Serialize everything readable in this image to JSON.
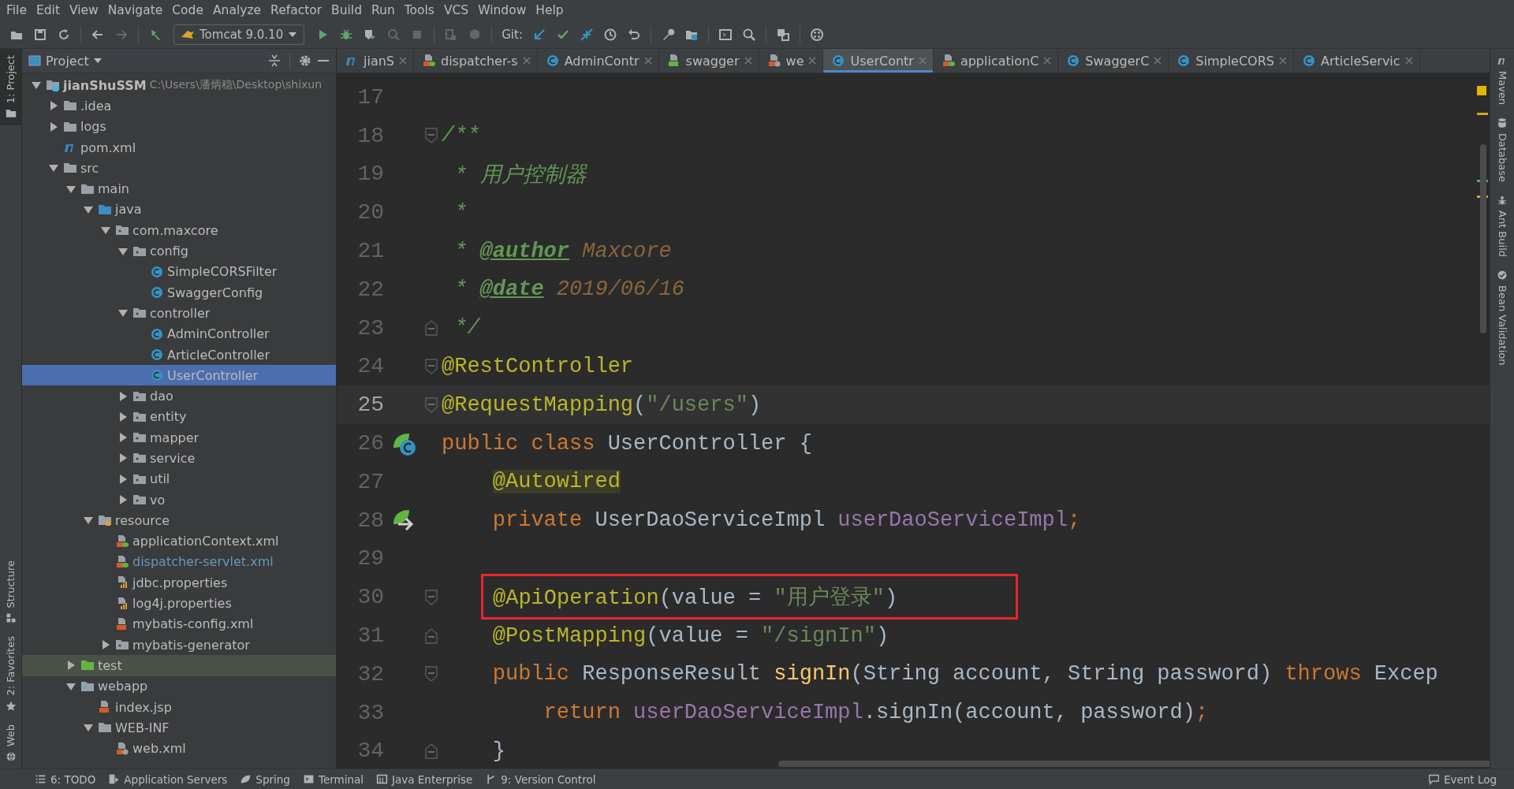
{
  "menu": [
    "File",
    "Edit",
    "View",
    "Navigate",
    "Code",
    "Analyze",
    "Refactor",
    "Build",
    "Run",
    "Tools",
    "VCS",
    "Window",
    "Help"
  ],
  "toolbar": {
    "items": [
      {
        "kind": "button",
        "disabled": false
      },
      {
        "kind": "button",
        "disabled": false
      },
      {
        "kind": "button",
        "disabled": false
      },
      {
        "kind": "separator"
      },
      {
        "kind": "button",
        "disabled": false
      },
      {
        "kind": "button",
        "disabled": true
      },
      {
        "kind": "separator"
      },
      {
        "kind": "button",
        "disabled": false
      },
      {
        "kind": "run-config",
        "label": "Tomcat 9.0.10"
      },
      {
        "kind": "button",
        "disabled": false
      },
      {
        "kind": "button",
        "disabled": false
      },
      {
        "kind": "button",
        "disabled": false
      },
      {
        "kind": "button",
        "disabled": true
      },
      {
        "kind": "button",
        "disabled": true
      },
      {
        "kind": "separator"
      },
      {
        "kind": "button",
        "disabled": true
      },
      {
        "kind": "button",
        "disabled": true
      },
      {
        "kind": "separator"
      },
      {
        "kind": "label",
        "text": "Git:"
      },
      {
        "kind": "button",
        "disabled": false
      },
      {
        "kind": "button",
        "disabled": false
      },
      {
        "kind": "button",
        "disabled": false
      },
      {
        "kind": "button",
        "disabled": false
      },
      {
        "kind": "button",
        "disabled": false
      },
      {
        "kind": "separator"
      },
      {
        "kind": "button",
        "disabled": false
      },
      {
        "kind": "button",
        "disabled": false
      },
      {
        "kind": "separator"
      },
      {
        "kind": "button",
        "disabled": false
      },
      {
        "kind": "button",
        "disabled": false
      },
      {
        "kind": "separator"
      },
      {
        "kind": "button",
        "disabled": false
      },
      {
        "kind": "separator"
      },
      {
        "kind": "button",
        "disabled": false
      }
    ]
  },
  "left_strip": [
    {
      "label": "1: Project",
      "selected": true
    },
    {
      "label": "Structure",
      "selected": false
    },
    {
      "label": "2: Favorites",
      "selected": false
    },
    {
      "label": "Web",
      "selected": false
    }
  ],
  "project": {
    "title": "Project",
    "tree": [
      {
        "name": "jianShuSSM",
        "path": "C:\\Users\\潘炳稳\\Desktop\\shixun",
        "kind": "module",
        "expanded": true,
        "selected": false,
        "modified": false,
        "children": [
          {
            "name": ".idea",
            "kind": "folder",
            "expanded": false,
            "selected": false,
            "modified": false
          },
          {
            "name": "logs",
            "kind": "folder",
            "expanded": false,
            "selected": false,
            "modified": false
          },
          {
            "name": "pom.xml",
            "kind": "maven",
            "selected": false,
            "modified": false
          },
          {
            "name": "src",
            "kind": "folder",
            "expanded": true,
            "selected": false,
            "modified": false,
            "children": [
              {
                "name": "main",
                "kind": "folder",
                "expanded": true,
                "selected": false,
                "modified": false,
                "children": [
                  {
                    "name": "java",
                    "kind": "source-folder",
                    "expanded": true,
                    "selected": false,
                    "modified": false,
                    "children": [
                      {
                        "name": "com.maxcore",
                        "kind": "package",
                        "expanded": true,
                        "selected": false,
                        "modified": false,
                        "children": [
                          {
                            "name": "config",
                            "kind": "package",
                            "expanded": true,
                            "selected": false,
                            "modified": false,
                            "children": [
                              {
                                "name": "SimpleCORSFilter",
                                "kind": "class",
                                "selected": false,
                                "modified": false
                              },
                              {
                                "name": "SwaggerConfig",
                                "kind": "class",
                                "selected": false,
                                "modified": false
                              }
                            ]
                          },
                          {
                            "name": "controller",
                            "kind": "package",
                            "expanded": true,
                            "selected": false,
                            "modified": false,
                            "children": [
                              {
                                "name": "AdminController",
                                "kind": "class",
                                "selected": false,
                                "modified": false
                              },
                              {
                                "name": "ArticleController",
                                "kind": "class",
                                "selected": false,
                                "modified": false
                              },
                              {
                                "name": "UserController",
                                "kind": "class",
                                "selected": true,
                                "modified": false
                              }
                            ]
                          },
                          {
                            "name": "dao",
                            "kind": "package",
                            "expanded": false,
                            "selected": false,
                            "modified": false
                          },
                          {
                            "name": "entity",
                            "kind": "package",
                            "expanded": false,
                            "selected": false,
                            "modified": false
                          },
                          {
                            "name": "mapper",
                            "kind": "package",
                            "expanded": false,
                            "selected": false,
                            "modified": false
                          },
                          {
                            "name": "service",
                            "kind": "package",
                            "expanded": false,
                            "selected": false,
                            "modified": false
                          },
                          {
                            "name": "util",
                            "kind": "package",
                            "expanded": false,
                            "selected": false,
                            "modified": false
                          },
                          {
                            "name": "vo",
                            "kind": "package",
                            "expanded": false,
                            "selected": false,
                            "modified": false
                          }
                        ]
                      }
                    ]
                  },
                  {
                    "name": "resource",
                    "kind": "resource-folder",
                    "expanded": true,
                    "selected": false,
                    "modified": false,
                    "children": [
                      {
                        "name": "applicationContext.xml",
                        "kind": "spring-xml",
                        "selected": false,
                        "modified": false
                      },
                      {
                        "name": "dispatcher-servlet.xml",
                        "kind": "spring-xml",
                        "selected": false,
                        "modified": true
                      },
                      {
                        "name": "jdbc.properties",
                        "kind": "properties",
                        "selected": false,
                        "modified": false
                      },
                      {
                        "name": "log4j.properties",
                        "kind": "properties",
                        "selected": false,
                        "modified": false
                      },
                      {
                        "name": "mybatis-config.xml",
                        "kind": "xml",
                        "selected": false,
                        "modified": false
                      },
                      {
                        "name": "mybatis-generator",
                        "kind": "package",
                        "expanded": false,
                        "selected": false,
                        "modified": false
                      }
                    ]
                  }
                ]
              },
              {
                "name": "test",
                "kind": "test-folder",
                "expanded": false,
                "selected": false,
                "modified": false
              },
              {
                "name": "webapp",
                "kind": "web-folder",
                "expanded": true,
                "selected": false,
                "modified": false,
                "children": [
                  {
                    "name": "index.jsp",
                    "kind": "jsp",
                    "selected": false,
                    "modified": false
                  },
                  {
                    "name": "WEB-INF",
                    "kind": "folder",
                    "expanded": true,
                    "selected": false,
                    "modified": false,
                    "children": [
                      {
                        "name": "web.xml",
                        "kind": "web-xml",
                        "selected": false,
                        "modified": false
                      }
                    ]
                  }
                ]
              }
            ]
          }
        ]
      }
    ]
  },
  "tabs": [
    {
      "label": "jianS",
      "kind": "maven",
      "selected": false
    },
    {
      "label": "dispatcher-s",
      "kind": "spring-xml",
      "selected": false
    },
    {
      "label": "AdminContr",
      "kind": "class",
      "selected": false
    },
    {
      "label": "swagger",
      "kind": "html",
      "selected": false
    },
    {
      "label": "we",
      "kind": "web-xml",
      "selected": false
    },
    {
      "label": "UserContr",
      "kind": "class",
      "selected": true
    },
    {
      "label": "applicationC",
      "kind": "spring-xml",
      "selected": false
    },
    {
      "label": "SwaggerC",
      "kind": "class",
      "selected": false
    },
    {
      "label": "SimpleCORS",
      "kind": "class",
      "selected": false
    },
    {
      "label": "ArticleServic",
      "kind": "class",
      "selected": false
    }
  ],
  "code": [
    {
      "number": "17",
      "current": false,
      "boxed": false,
      "fold_start": false,
      "fold_end": false
    },
    {
      "number": "18",
      "current": false,
      "boxed": false,
      "fold_start": true,
      "fold_end": false,
      "tokens": [
        {
          "text": "/**",
          "kind": "comment"
        }
      ]
    },
    {
      "number": "19",
      "current": false,
      "boxed": false,
      "fold_start": false,
      "fold_end": false,
      "tokens": [
        {
          "text": " * 用户控制器",
          "kind": "comment"
        }
      ]
    },
    {
      "number": "20",
      "current": false,
      "boxed": false,
      "fold_start": false,
      "fold_end": false,
      "tokens": [
        {
          "text": " *",
          "kind": "comment"
        }
      ]
    },
    {
      "number": "21",
      "current": false,
      "boxed": false,
      "fold_start": false,
      "fold_end": false,
      "tokens": [
        {
          "text": " * ",
          "kind": "comment"
        },
        {
          "text": "@author",
          "kind": "doctag"
        },
        {
          "text": " Maxcore",
          "kind": "docval"
        }
      ]
    },
    {
      "number": "22",
      "current": false,
      "boxed": false,
      "fold_start": false,
      "fold_end": false,
      "tokens": [
        {
          "text": " * ",
          "kind": "comment"
        },
        {
          "text": "@date",
          "kind": "doctag"
        },
        {
          "text": " 2019/06/16",
          "kind": "docval"
        }
      ]
    },
    {
      "number": "23",
      "current": false,
      "boxed": false,
      "fold_start": false,
      "fold_end": true,
      "tokens": [
        {
          "text": " */",
          "kind": "comment"
        }
      ]
    },
    {
      "number": "24",
      "current": false,
      "boxed": false,
      "fold_start": true,
      "fold_end": false,
      "tokens": [
        {
          "text": "@RestController",
          "kind": "annotation"
        }
      ]
    },
    {
      "number": "25",
      "current": true,
      "boxed": false,
      "fold_start": true,
      "fold_end": false,
      "tokens": [
        {
          "text": "@RequestMapping",
          "kind": "annotation"
        },
        {
          "text": "(",
          "kind": "plain"
        },
        {
          "text": "\"/users\"",
          "kind": "string"
        },
        {
          "text": ")",
          "kind": "plain"
        }
      ]
    },
    {
      "number": "26",
      "current": false,
      "boxed": false,
      "fold_start": false,
      "fold_end": false,
      "gutter": {
        "kind": "bean"
      },
      "tokens": [
        {
          "text": "public class",
          "kind": "keyword"
        },
        {
          "text": " UserController {",
          "kind": "plain"
        }
      ]
    },
    {
      "number": "27",
      "current": false,
      "boxed": false,
      "fold_start": false,
      "fold_end": false,
      "tokens": [
        {
          "text": "    @Autowired",
          "kind": "annotation-hl"
        }
      ]
    },
    {
      "number": "28",
      "current": false,
      "boxed": false,
      "fold_start": false,
      "fold_end": false,
      "gutter": {
        "kind": "inject"
      },
      "tokens": [
        {
          "text": "    private",
          "kind": "keyword"
        },
        {
          "text": " UserDaoServiceImpl ",
          "kind": "plain"
        },
        {
          "text": "userDaoServiceImpl",
          "kind": "field"
        },
        {
          "text": ";",
          "kind": "keyword"
        }
      ]
    },
    {
      "number": "29",
      "current": false,
      "boxed": false,
      "fold_start": false,
      "fold_end": false
    },
    {
      "number": "30",
      "current": false,
      "boxed": true,
      "fold_start": true,
      "fold_end": false,
      "tokens": [
        {
          "text": "@ApiOperation",
          "kind": "annotation"
        },
        {
          "text": "(value = ",
          "kind": "plain"
        },
        {
          "text": "\"用户登录\"",
          "kind": "string"
        },
        {
          "text": ")",
          "kind": "plain"
        }
      ]
    },
    {
      "number": "31",
      "current": false,
      "boxed": false,
      "fold_start": false,
      "fold_end": true,
      "tokens": [
        {
          "text": "    @PostMapping",
          "kind": "annotation"
        },
        {
          "text": "(value = ",
          "kind": "plain"
        },
        {
          "text": "\"/signIn\"",
          "kind": "string"
        },
        {
          "text": ")",
          "kind": "plain"
        }
      ]
    },
    {
      "number": "32",
      "current": false,
      "boxed": false,
      "fold_start": true,
      "fold_end": false,
      "tokens": [
        {
          "text": "    public",
          "kind": "keyword"
        },
        {
          "text": " ResponseResult ",
          "kind": "plain"
        },
        {
          "text": "signIn",
          "kind": "method"
        },
        {
          "text": "(String account, String password) ",
          "kind": "plain"
        },
        {
          "text": "throws",
          "kind": "keyword"
        },
        {
          "text": " Excep",
          "kind": "plain"
        }
      ]
    },
    {
      "number": "33",
      "current": false,
      "boxed": false,
      "fold_start": false,
      "fold_end": false,
      "tokens": [
        {
          "text": "        return",
          "kind": "keyword"
        },
        {
          "text": " userDaoServiceImpl",
          "kind": "field"
        },
        {
          "text": ".signIn(account, password)",
          "kind": "plain"
        },
        {
          "text": ";",
          "kind": "keyword"
        }
      ]
    },
    {
      "number": "34",
      "current": false,
      "boxed": false,
      "fold_start": false,
      "fold_end": true,
      "tokens": [
        {
          "text": "    }",
          "kind": "plain"
        }
      ]
    }
  ],
  "right_strip": [
    {
      "label": "Maven"
    },
    {
      "label": "Database"
    },
    {
      "label": "Ant Build"
    },
    {
      "label": "Bean Validation"
    }
  ],
  "status_bar": {
    "left": [
      {
        "label": "6: TODO"
      },
      {
        "label": "Application Servers"
      },
      {
        "label": "Spring"
      },
      {
        "label": "Terminal"
      },
      {
        "label": "Java Enterprise"
      },
      {
        "label": "9: Version Control"
      }
    ],
    "right": [
      {
        "label": "Event Log"
      }
    ]
  }
}
